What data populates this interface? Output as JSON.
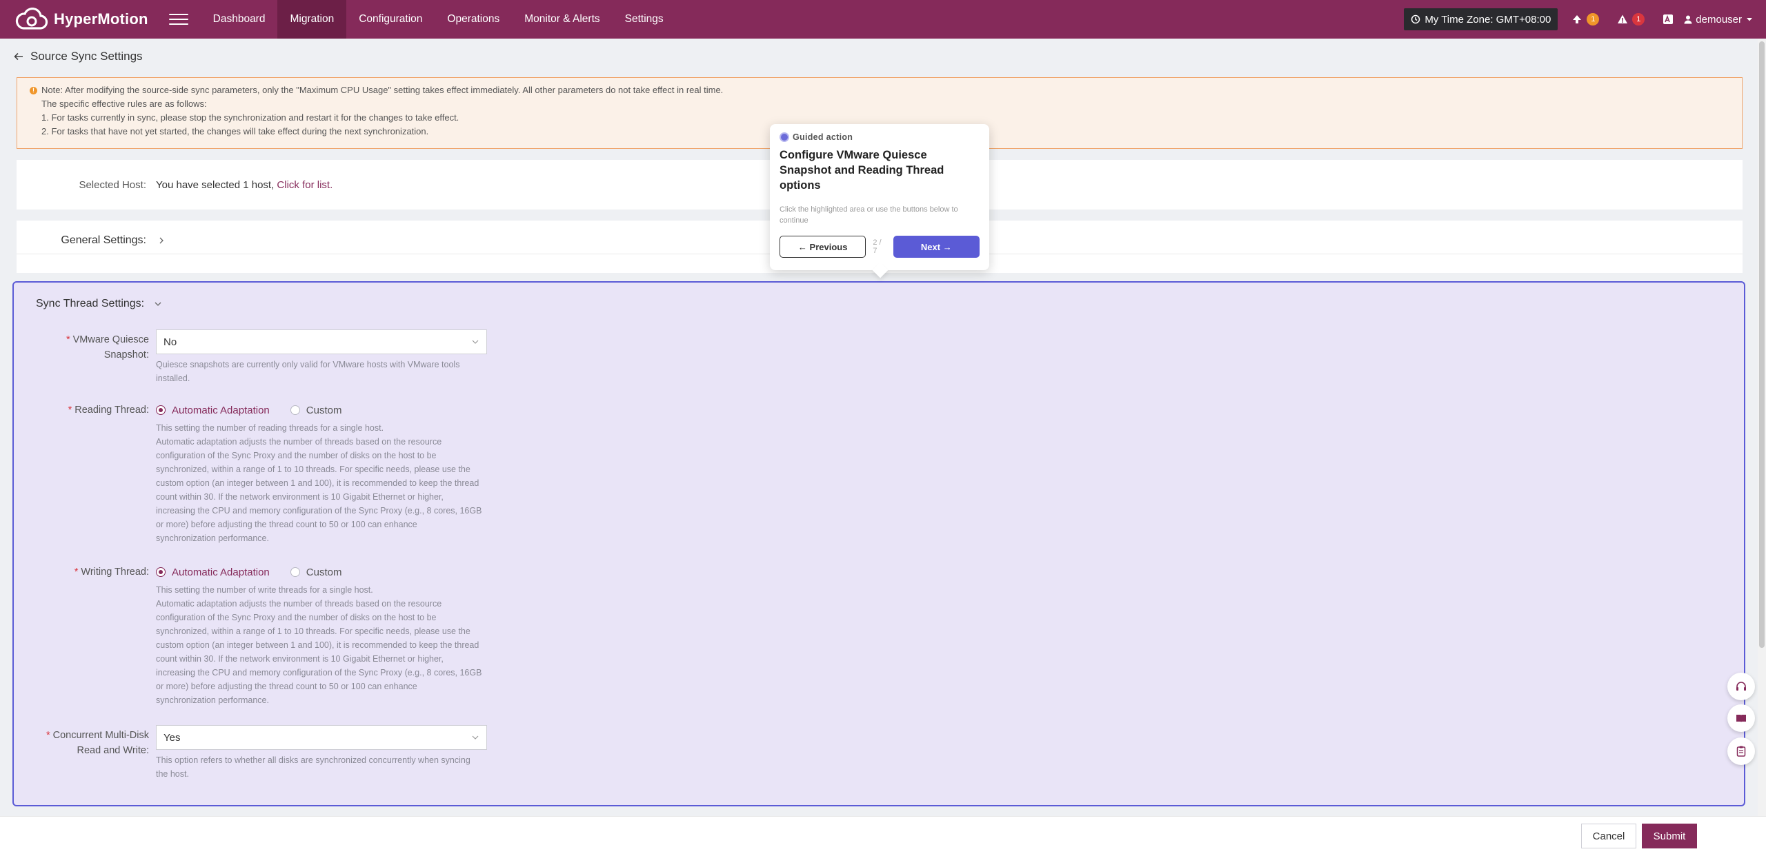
{
  "app": {
    "brand": "HyperMotion"
  },
  "nav": {
    "items": [
      "Dashboard",
      "Migration",
      "Configuration",
      "Operations",
      "Monitor & Alerts",
      "Settings"
    ],
    "active": "Migration"
  },
  "topbar": {
    "timezone": "My Time Zone: GMT+08:00",
    "upload_badge": "1",
    "alert_badge": "1",
    "user": "demouser"
  },
  "page": {
    "title": "Source Sync Settings"
  },
  "note": {
    "line1": "Note: After modifying the source-side sync parameters, only the \"Maximum CPU Usage\" setting takes effect immediately. All other parameters do not take effect in real time.",
    "line2": "The specific effective rules are as follows:",
    "line3": "1. For tasks currently in sync, please stop the synchronization and restart it for the changes to take effect.",
    "line4": "2. For tasks that have not yet started, the changes will take effect during the next synchronization."
  },
  "host": {
    "label": "Selected Host:",
    "text": "You have selected 1 host,",
    "link": "Click for list."
  },
  "general": {
    "title": "General Settings:"
  },
  "sync": {
    "title": "Sync Thread Settings:",
    "quiesce": {
      "label_line1": "VMware Quiesce",
      "label_line2": "Snapshot:",
      "value": "No",
      "help_line1": "Quiesce snapshots are currently only valid for VMware hosts with VMware tools",
      "help_line2": "installed."
    },
    "reading": {
      "label": "Reading Thread:",
      "option_auto": "Automatic Adaptation",
      "option_custom": "Custom",
      "help": [
        "This setting the number of reading threads for a single host.",
        "Automatic adaptation adjusts the number of threads based on the resource",
        "configuration of the Sync Proxy and the number of disks on the host to be",
        "synchronized, within a range of 1 to 10 threads. For specific needs, please use the",
        "custom option (an integer between 1 and 100), it is recommended to keep the thread",
        "count within 30. If the network environment is 10 Gigabit Ethernet or higher,",
        "increasing the CPU and memory configuration of the Sync Proxy (e.g., 8 cores, 16GB",
        "or more) before adjusting the thread count to 50 or 100 can enhance",
        "synchronization performance."
      ]
    },
    "writing": {
      "label": "Writing Thread:",
      "option_auto": "Automatic Adaptation",
      "option_custom": "Custom",
      "help": [
        "This setting the number of write threads for a single host.",
        "Automatic adaptation adjusts the number of threads based on the resource",
        "configuration of the Sync Proxy and the number of disks on the host to be",
        "synchronized, within a range of 1 to 10 threads. For specific needs, please use the",
        "custom option (an integer between 1 and 100), it is recommended to keep the thread",
        "count within 30. If the network environment is 10 Gigabit Ethernet or higher,",
        "increasing the CPU and memory configuration of the Sync Proxy (e.g., 8 cores, 16GB",
        "or more) before adjusting the thread count to 50 or 100 can enhance",
        "synchronization performance."
      ]
    },
    "multidisk": {
      "label_line1": "Concurrent Multi-Disk",
      "label_line2": "Read and Write:",
      "value": "Yes",
      "help_line1": "This option refers to whether all disks are synchronized concurrently when syncing",
      "help_line2": "the host."
    }
  },
  "guide": {
    "tag": "Guided action",
    "title": "Configure VMware Quiesce Snapshot and Reading Thread options",
    "desc": "Click the highlighted area or use the buttons below to continue",
    "prev": "← Previous",
    "step": "2 / 7",
    "next": "Next →"
  },
  "footer": {
    "cancel": "Cancel",
    "submit": "Submit"
  },
  "colors": {
    "brand": "#852a5a",
    "guide_accent": "#5b5bd6",
    "highlight_bg": "#e9e4f7"
  }
}
